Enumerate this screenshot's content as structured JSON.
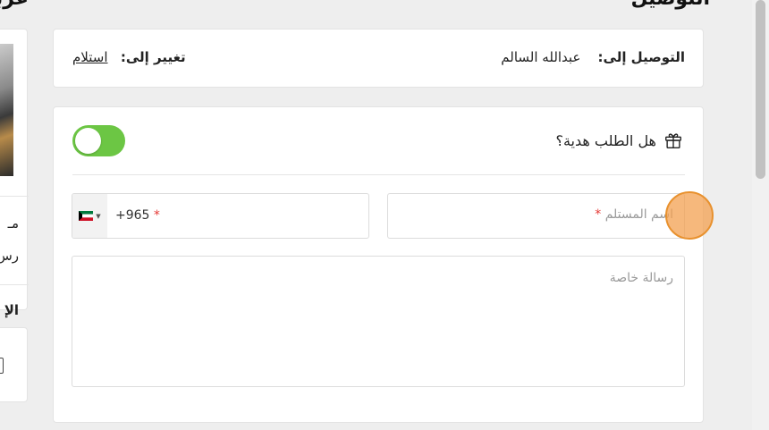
{
  "heading": {
    "section_title": "التوصيل",
    "left_title": "عربة"
  },
  "delivery": {
    "label": "التوصيل إلى:",
    "recipient": "عبدالله السالم",
    "change_label": "تغيير إلى:",
    "change_link": "استلام"
  },
  "gift": {
    "question": "هل الطلب هدية؟",
    "toggle_on": true,
    "recipient_name_placeholder": "اسم المستلم",
    "required_mark": "*",
    "phone_code": "+965",
    "phone_country": "Kuwait",
    "message_placeholder": "رسالة خاصة"
  },
  "left_column": {
    "line1": "مـ",
    "line2": "رس",
    "line3": "الإ"
  },
  "colors": {
    "toggle": "#6cc644",
    "required": "#e53935",
    "cursor": "#f3a050"
  }
}
